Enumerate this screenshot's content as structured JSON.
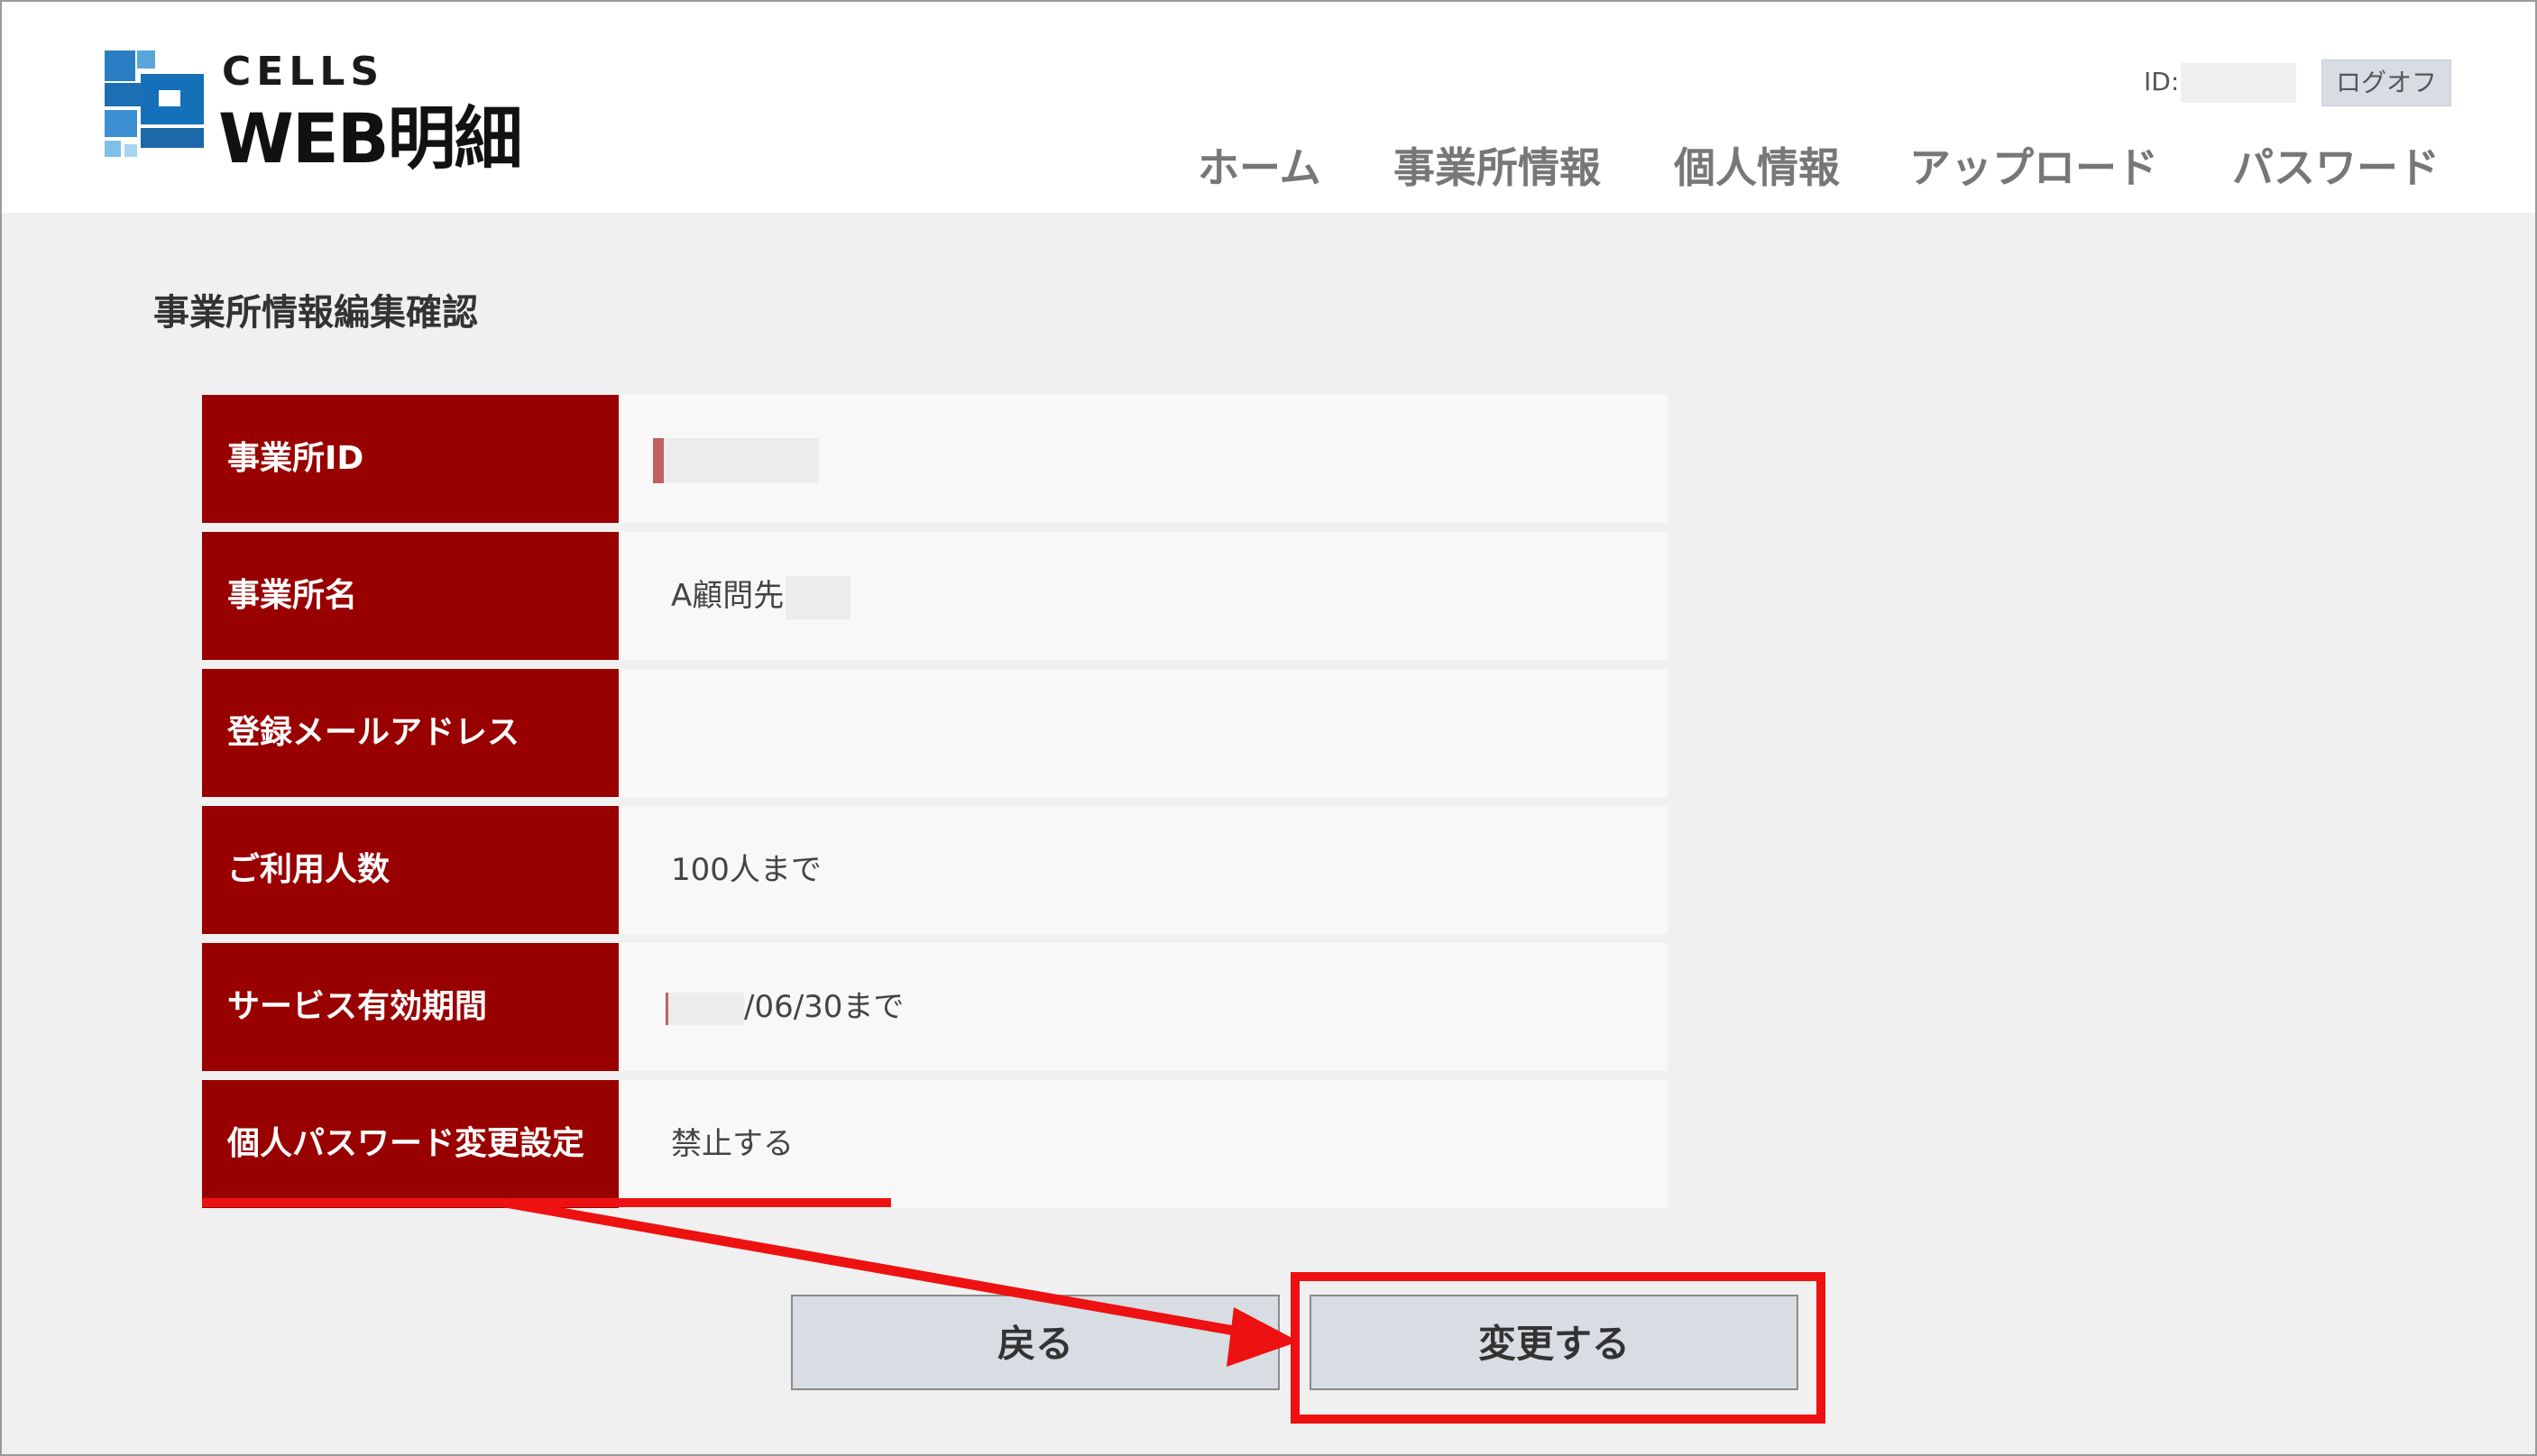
{
  "header": {
    "logo_top": "CELLS",
    "logo_bottom": "WEB明細",
    "id_label": "ID:",
    "logoff_label": "ログオフ",
    "nav": {
      "home": "ホーム",
      "office": "事業所情報",
      "person": "個人情報",
      "upload": "アップロード",
      "password": "パスワード"
    }
  },
  "main": {
    "title": "事業所情報編集確認",
    "rows": [
      {
        "label": "事業所ID",
        "value": ""
      },
      {
        "label": "事業所名",
        "value": "A顧問先"
      },
      {
        "label": "登録メールアドレス",
        "value": ""
      },
      {
        "label": "ご利用人数",
        "value": "100人まで"
      },
      {
        "label": "サービス有効期間",
        "value": "/06/30まで"
      },
      {
        "label": "個人パスワード変更設定",
        "value": "禁止する"
      }
    ]
  },
  "buttons": {
    "back": "戻る",
    "change": "変更する"
  },
  "colors": {
    "label_bg": "#990000",
    "annotation": "#ee1111",
    "button_bg": "#d8dde3"
  }
}
